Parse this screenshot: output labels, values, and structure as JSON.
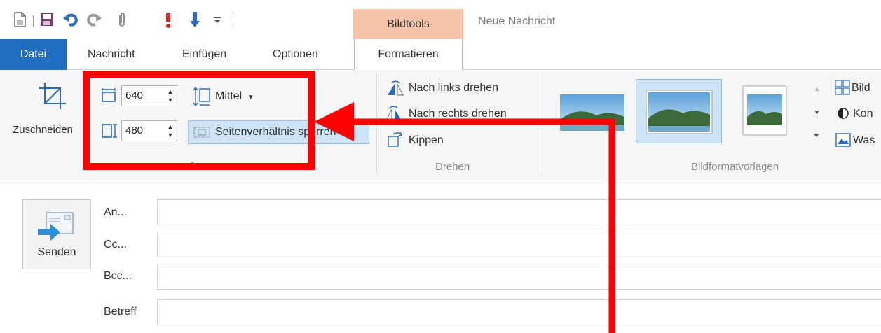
{
  "window": {
    "title": "Neue Nachricht",
    "contextual_tab_group": "Bildtools"
  },
  "quick_access": {
    "icons": [
      "new-document-icon",
      "save-icon",
      "undo-icon",
      "redo-icon",
      "attach-icon",
      "high-priority-icon",
      "low-priority-icon",
      "customize-dropdown-icon"
    ]
  },
  "tabs": [
    {
      "label": "Datei",
      "active": false
    },
    {
      "label": "Nachricht",
      "active": false
    },
    {
      "label": "Einfügen",
      "active": false
    },
    {
      "label": "Optionen",
      "active": false
    },
    {
      "label": "Formatieren",
      "active": true
    }
  ],
  "ribbon": {
    "crop": {
      "label": "Zuschneiden",
      "icon": "crop-icon"
    },
    "size": {
      "width_value": "640",
      "height_value": "480",
      "quality_label": "Mittel",
      "lock_aspect_label": "Seitenverhältnis sperren",
      "group_label": "Größe"
    },
    "rotate": {
      "rotate_left": "Nach links drehen",
      "rotate_right": "Nach rechts drehen",
      "flip": "Kippen",
      "group_label": "Drehen"
    },
    "styles": {
      "group_label": "Bildformatvorlagen",
      "selected_index": 1
    },
    "extras": [
      "Bild",
      "Kon",
      "Was"
    ]
  },
  "message": {
    "send_label": "Senden",
    "to_label": "An...",
    "cc_label": "Cc...",
    "bcc_label": "Bcc...",
    "subject_label": "Betreff",
    "to_value": "",
    "cc_value": "",
    "bcc_value": "",
    "subject_value": ""
  },
  "colors": {
    "file_tab": "#1f6ebf",
    "contextual_tab": "#f5c4a8",
    "selection": "#cde4f7",
    "annotation": "#ff0000"
  }
}
